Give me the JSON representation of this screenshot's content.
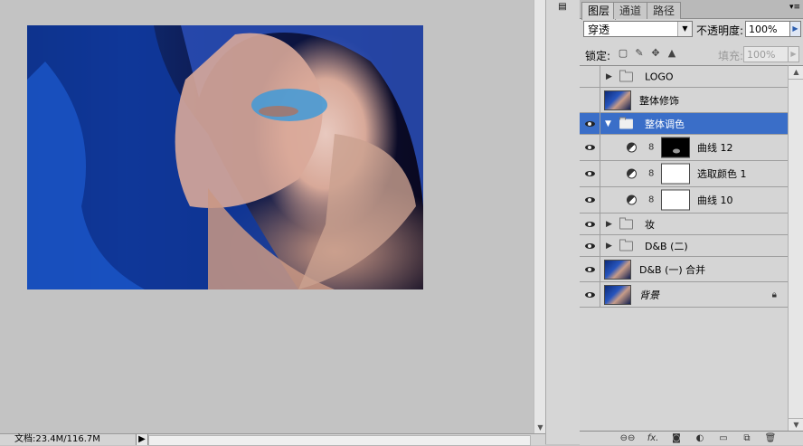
{
  "status": {
    "doc_info": "文档:23.4M/116.7M"
  },
  "panel": {
    "tabs": [
      "图层",
      "通道",
      "路径"
    ],
    "blend_mode": "穿透",
    "opacity_label": "不透明度:",
    "opacity_value": "100%",
    "lock_label": "锁定:",
    "fill_label": "填充:",
    "fill_value": "100%",
    "layers": [
      {
        "name": "LOGO",
        "visible": false,
        "kind": "group",
        "expanded": false
      },
      {
        "name": "整体修饰",
        "visible": false,
        "kind": "pixel"
      },
      {
        "name": "整体调色",
        "visible": true,
        "kind": "group",
        "expanded": true,
        "selected": true
      },
      {
        "name": "曲线 12",
        "visible": true,
        "kind": "adjustment",
        "mask": "black"
      },
      {
        "name": "选取颜色 1",
        "visible": true,
        "kind": "adjustment",
        "mask": "white"
      },
      {
        "name": "曲线 10",
        "visible": true,
        "kind": "adjustment",
        "mask": "white"
      },
      {
        "name": "妆",
        "visible": true,
        "kind": "group",
        "expanded": false
      },
      {
        "name": "D&B (二)",
        "visible": true,
        "kind": "group",
        "expanded": false
      },
      {
        "name": "D&B (一) 合并",
        "visible": true,
        "kind": "pixel"
      },
      {
        "name": "背景",
        "visible": true,
        "kind": "pixel",
        "locked": true
      }
    ]
  },
  "colors": {
    "selection": "#3a6ec8",
    "panel_bg": "#d5d5d5",
    "canvas_bg": "#c3c3c3"
  }
}
